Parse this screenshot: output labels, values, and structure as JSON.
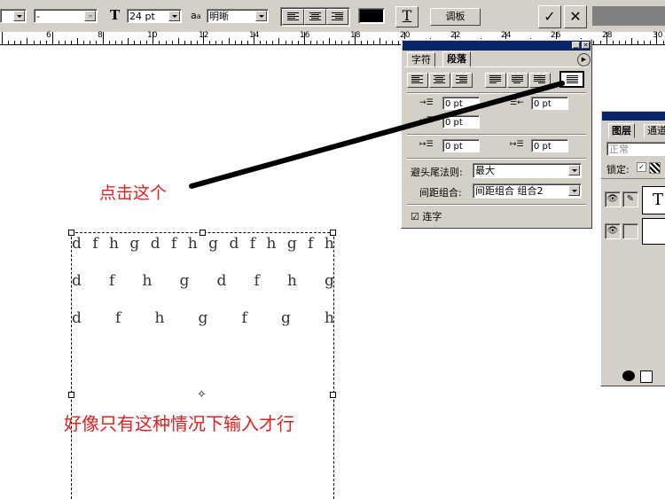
{
  "toolbar": {
    "combo_left_value": "",
    "style_value": "-",
    "font_size_value": "24 pt",
    "antialias_label": "a",
    "antialias_value": "明晰",
    "warp_icon_label": "T",
    "palettes_label": "调板",
    "color_swatch": "#000000",
    "confirm_label": "✓",
    "cancel_label": "✕"
  },
  "ruler": {
    "labels": [
      "6",
      "8",
      "10",
      "12",
      "14",
      "16",
      "18",
      "20",
      "22",
      "24",
      "26",
      "28",
      "30"
    ]
  },
  "canvas": {
    "text_rows": [
      [
        "d",
        "f",
        "h",
        "g",
        "d",
        "f",
        "h",
        "g",
        "d",
        "f",
        "h",
        "g",
        "f",
        "h"
      ],
      [
        "d",
        "f",
        "h",
        "g",
        "d",
        "f",
        "h",
        "g"
      ],
      [
        "d",
        "f",
        "h",
        "g",
        "f",
        "g",
        "h"
      ]
    ],
    "annotation_click": "点击这个",
    "annotation_note": "好像只有这种情况下输入才行"
  },
  "paragraph_panel": {
    "tab_character": "字符",
    "tab_paragraph": "段落",
    "indent_left": "0 pt",
    "indent_right": "0 pt",
    "indent_first": "0 pt",
    "space_before": "0 pt",
    "space_after": "0 pt",
    "kinsoku_label": "避头尾法则:",
    "kinsoku_value": "最大",
    "mojikumi_label": "间距组合:",
    "mojikumi_value": "间距组合 组合2",
    "hyphenate_label": "连字",
    "hyphenate_checked": "☑"
  },
  "layers_panel": {
    "tab_layers": "图层",
    "tab_channels": "通道",
    "blend_mode": "正常",
    "lock_label": "锁定:",
    "layer_text_icon": "T"
  },
  "colors": {
    "annotation": "#e02020",
    "title_bar": "#0a246a",
    "panel_bg": "#d4d0c8"
  }
}
